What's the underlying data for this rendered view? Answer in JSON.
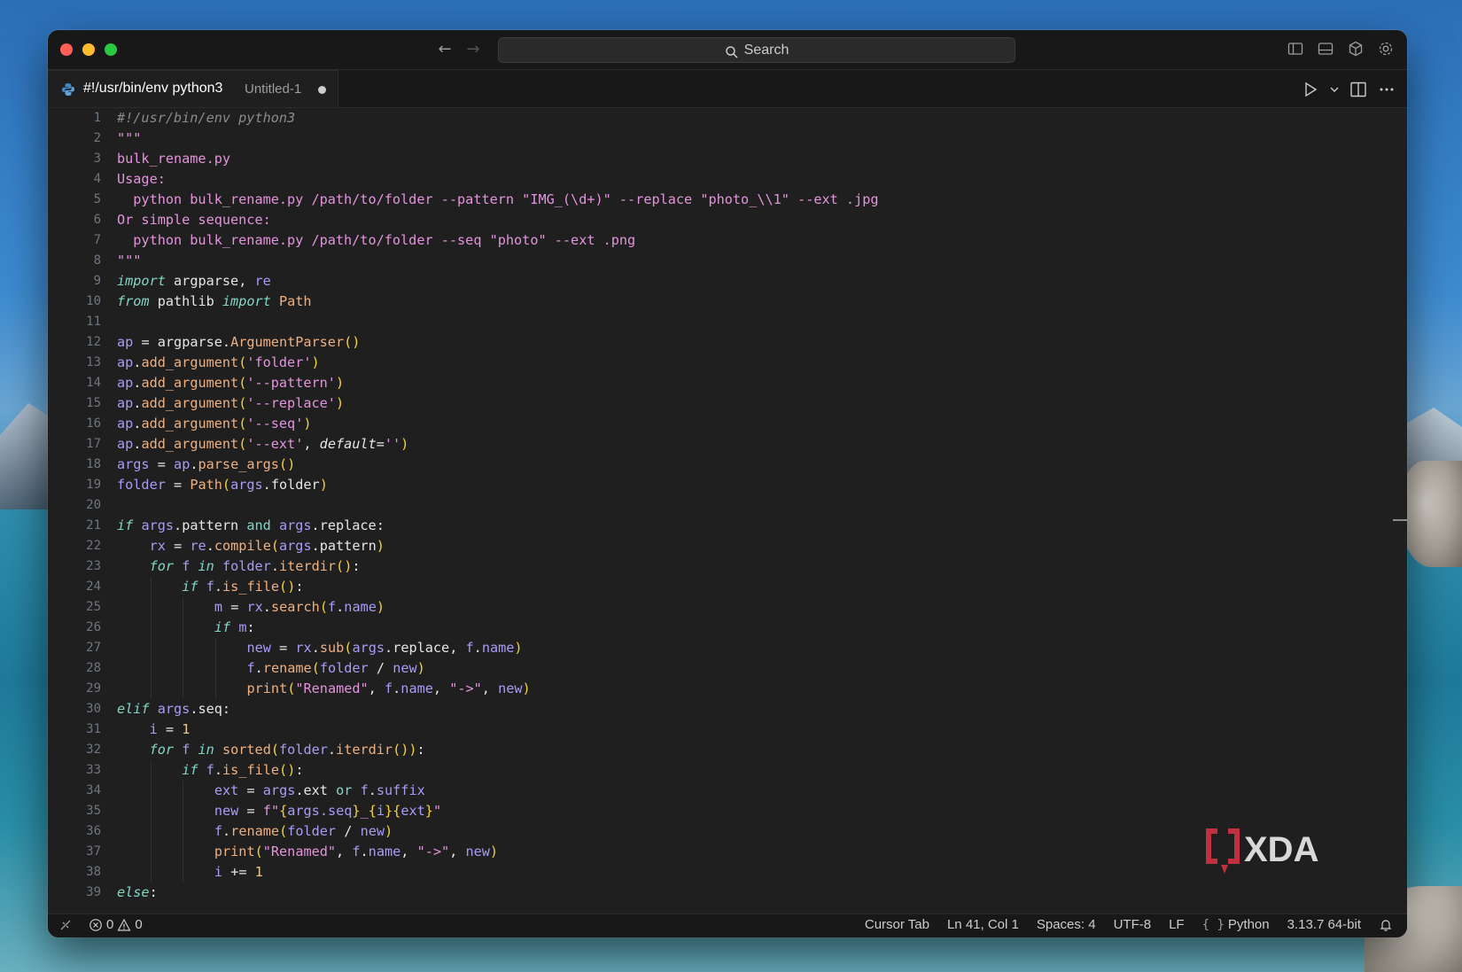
{
  "window": {
    "search_placeholder": "Search"
  },
  "tab": {
    "title": "#!/usr/bin/env python3",
    "description": "Untitled-1"
  },
  "editor": {
    "line_numbers": [
      "1",
      "2",
      "3",
      "4",
      "5",
      "6",
      "7",
      "8",
      "9",
      "10",
      "11",
      "12",
      "13",
      "14",
      "15",
      "16",
      "17",
      "18",
      "19",
      "20",
      "21",
      "22",
      "23",
      "24",
      "25",
      "26",
      "27",
      "28",
      "29",
      "30",
      "31",
      "32",
      "33",
      "34",
      "35",
      "36",
      "37",
      "38",
      "39"
    ],
    "lines": [
      "#!/usr/bin/env python3",
      "\"\"\"",
      "bulk_rename.py",
      "Usage:",
      "  python bulk_rename.py /path/to/folder --pattern \"IMG_(\\d+)\" --replace \"photo_\\\\1\" --ext .jpg",
      "Or simple sequence:",
      "  python bulk_rename.py /path/to/folder --seq \"photo\" --ext .png",
      "\"\"\"",
      "import argparse, re",
      "from pathlib import Path",
      "",
      "ap = argparse.ArgumentParser()",
      "ap.add_argument('folder')",
      "ap.add_argument('--pattern')",
      "ap.add_argument('--replace')",
      "ap.add_argument('--seq')",
      "ap.add_argument('--ext', default='')",
      "args = ap.parse_args()",
      "folder = Path(args.folder)",
      "",
      "if args.pattern and args.replace:",
      "    rx = re.compile(args.pattern)",
      "    for f in folder.iterdir():",
      "        if f.is_file():",
      "            m = rx.search(f.name)",
      "            if m:",
      "                new = rx.sub(args.replace, f.name)",
      "                f.rename(folder / new)",
      "                print(\"Renamed\", f.name, \"->\", new)",
      "elif args.seq:",
      "    i = 1",
      "    for f in sorted(folder.iterdir()):",
      "        if f.is_file():",
      "            ext = args.ext or f.suffix",
      "            new = f\"{args.seq}_{i}{ext}\"",
      "            f.rename(folder / new)",
      "            print(\"Renamed\", f.name, \"->\", new)",
      "            i += 1",
      "else:"
    ],
    "colors": {
      "comment": "#8b8b8b",
      "docstring": "#e394dc",
      "keyword": "#83d6c5",
      "variable": "#aa9bf5",
      "function": "#efb080",
      "string": "#e394dc",
      "number": "#ebc88d",
      "bracket": "#f5d442",
      "plain": "#e6e6e6"
    }
  },
  "statusbar": {
    "errors": "0",
    "warnings": "0",
    "cursor_tab": "Cursor Tab",
    "position": "Ln 41, Col 1",
    "spaces": "Spaces: 4",
    "encoding": "UTF-8",
    "eol": "LF",
    "language": "Python",
    "interpreter": "3.13.7 64-bit"
  },
  "watermark": {
    "text": "XDA"
  }
}
